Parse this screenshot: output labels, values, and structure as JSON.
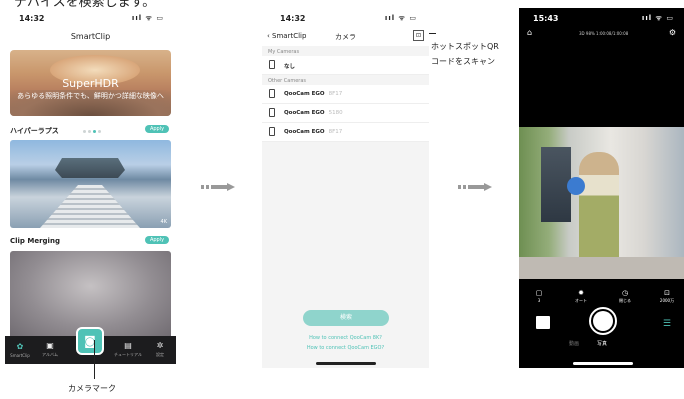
{
  "top_instruction": "デバイスを検索します。",
  "phone1": {
    "time": "14:32",
    "status_icons": "ııl ᯤ ▭",
    "title": "SmartClip",
    "banner": {
      "title": "SuperHDR",
      "subtitle": "あらゆる照明条件でも、鮮明かつ詳細な映像へ"
    },
    "section1": {
      "title": "ハイパーラプス",
      "apply": "Apply",
      "badge": "4K"
    },
    "section2": {
      "title": "Clip Merging",
      "apply": "Apply"
    },
    "tabs": [
      {
        "icon": "smartclip-icon",
        "label": "SmartClip"
      },
      {
        "icon": "album-icon",
        "label": "アルバム"
      },
      {
        "icon": "camera-icon",
        "label": ""
      },
      {
        "icon": "tutorial-icon",
        "label": "チュートリアル"
      },
      {
        "icon": "settings-icon",
        "label": "設定"
      }
    ]
  },
  "phone2": {
    "time": "14:32",
    "status_icons": "ııl ᯤ ▭",
    "back_label": "SmartClip",
    "title": "カメラ",
    "my_cameras_header": "My Cameras",
    "my_cameras": [
      {
        "name": "なし",
        "serial": ""
      }
    ],
    "other_cameras_header": "Other Cameras",
    "other_cameras": [
      {
        "name": "QooCam EGO",
        "serial": "8F17"
      },
      {
        "name": "QooCam EGO",
        "serial": "5180"
      },
      {
        "name": "QooCam EGO",
        "serial": "8F17"
      }
    ],
    "search_button": "検索",
    "link1": "How to connect QooCam 8K?",
    "link2": "How to connect QooCam EGO?"
  },
  "phone3": {
    "time": "15:43",
    "status_icons": "ııl ᯤ ▭",
    "info": "3D  98%  1:00:08/1:00:08",
    "modes": [
      {
        "icon": "▢",
        "label": "3"
      },
      {
        "icon": "✹",
        "label": "オート"
      },
      {
        "icon": "◷",
        "label": "閉じる"
      },
      {
        "icon": "⊡",
        "label": "2000万"
      }
    ],
    "mode_labels": [
      "動画",
      "写真"
    ]
  },
  "annotations": {
    "qr_scan": "ホットスポットQR\nコードをスキャン",
    "camera_mark": "カメラマーク"
  }
}
